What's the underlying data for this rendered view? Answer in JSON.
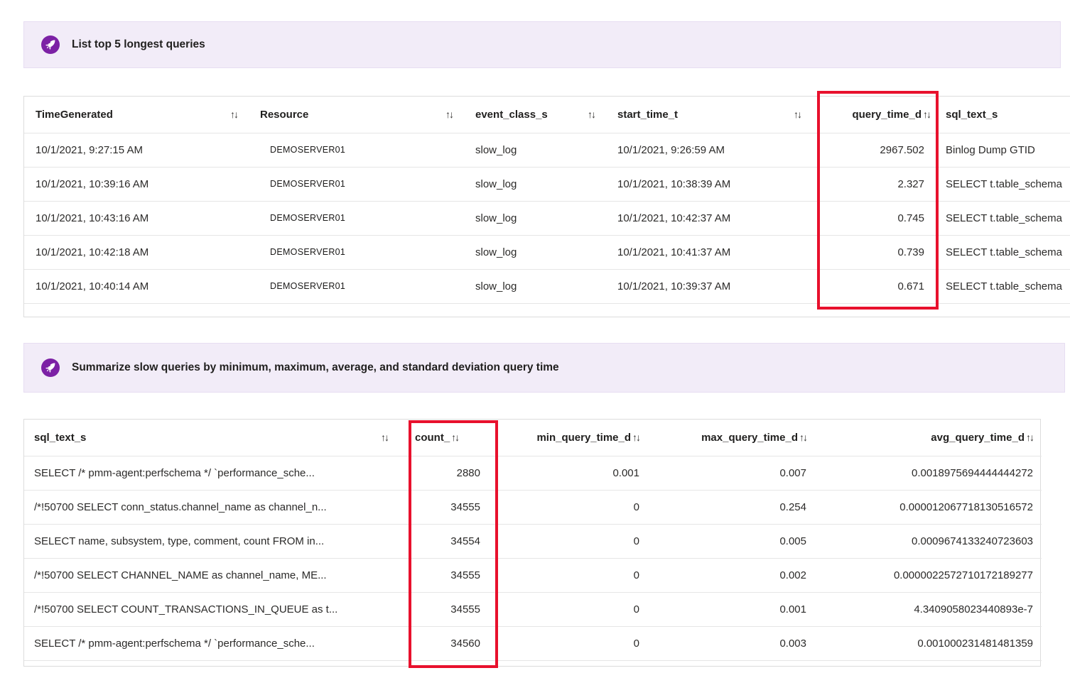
{
  "colors": {
    "accent": "#7c21a5",
    "banner_bg": "#f2ecf8",
    "highlight": "#e8112d"
  },
  "sort_icon": "↑↓",
  "prompt_cards": [
    {
      "label": "List top 5 longest queries"
    },
    {
      "label": "Summarize slow queries by minimum, maximum, average, and standard deviation query time"
    }
  ],
  "table1": {
    "headers": [
      "TimeGenerated",
      "Resource",
      "event_class_s",
      "start_time_t",
      "query_time_d",
      "sql_text_s"
    ],
    "rows": [
      [
        "10/1/2021, 9:27:15 AM",
        "DEMOSERVER01",
        "slow_log",
        "10/1/2021, 9:26:59 AM",
        "2967.502",
        "Binlog Dump GTID"
      ],
      [
        "10/1/2021, 10:39:16 AM",
        "DEMOSERVER01",
        "slow_log",
        "10/1/2021, 10:38:39 AM",
        "2.327",
        "SELECT t.table_schema"
      ],
      [
        "10/1/2021, 10:43:16 AM",
        "DEMOSERVER01",
        "slow_log",
        "10/1/2021, 10:42:37 AM",
        "0.745",
        "SELECT t.table_schema"
      ],
      [
        "10/1/2021, 10:42:18 AM",
        "DEMOSERVER01",
        "slow_log",
        "10/1/2021, 10:41:37 AM",
        "0.739",
        "SELECT t.table_schema"
      ],
      [
        "10/1/2021, 10:40:14 AM",
        "DEMOSERVER01",
        "slow_log",
        "10/1/2021, 10:39:37 AM",
        "0.671",
        "SELECT t.table_schema"
      ]
    ]
  },
  "table2": {
    "headers": [
      "sql_text_s",
      "count_",
      "min_query_time_d",
      "max_query_time_d",
      "avg_query_time_d"
    ],
    "rows": [
      [
        "SELECT /* pmm-agent:perfschema */ `performance_sche...",
        "2880",
        "0.001",
        "0.007",
        "0.0018975694444444272"
      ],
      [
        "/*!50700 SELECT conn_status.channel_name as channel_n...",
        "34555",
        "0",
        "0.254",
        "0.000012067718130516572"
      ],
      [
        "SELECT name, subsystem, type, comment, count FROM in...",
        "34554",
        "0",
        "0.005",
        "0.0009674133240723603"
      ],
      [
        "/*!50700 SELECT CHANNEL_NAME as channel_name, ME...",
        "34555",
        "0",
        "0.002",
        "0.0000022572710172189277"
      ],
      [
        "/*!50700 SELECT COUNT_TRANSACTIONS_IN_QUEUE as t...",
        "34555",
        "0",
        "0.001",
        "4.3409058023440893e-7"
      ],
      [
        "SELECT /* pmm-agent:perfschema */ `performance_sche...",
        "34560",
        "0",
        "0.003",
        "0.001000231481481359"
      ]
    ]
  }
}
